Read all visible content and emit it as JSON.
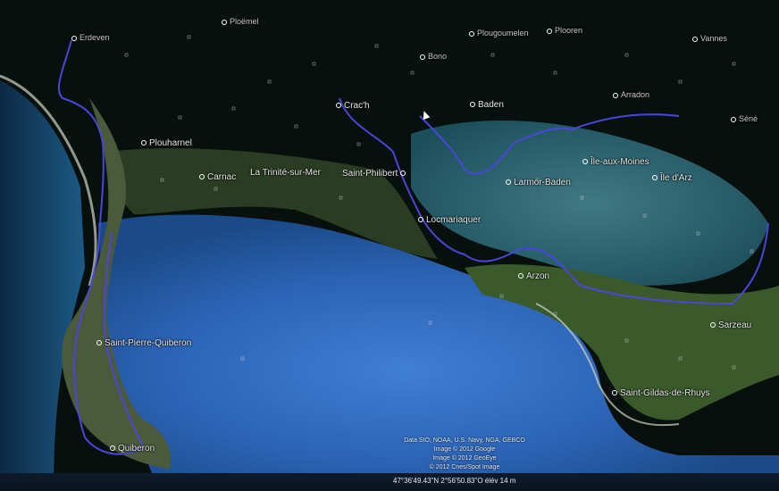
{
  "map": {
    "places": [
      {
        "id": "ploemel",
        "label": "Ploëmel",
        "faint": true
      },
      {
        "id": "erdeven",
        "label": "Erdeven",
        "faint": true
      },
      {
        "id": "plougoumelen",
        "label": "Plougoumelen",
        "faint": true
      },
      {
        "id": "plooren",
        "label": "Plooren",
        "faint": true
      },
      {
        "id": "vannes",
        "label": "Vannes",
        "faint": true
      },
      {
        "id": "bono",
        "label": "Bono",
        "faint": true
      },
      {
        "id": "arradon",
        "label": "Arradon",
        "faint": true
      },
      {
        "id": "crach",
        "label": "Crac'h",
        "faint": false
      },
      {
        "id": "baden",
        "label": "Baden",
        "faint": false
      },
      {
        "id": "sene",
        "label": "Séné",
        "faint": true
      },
      {
        "id": "plouharnel",
        "label": "Plouharnel",
        "faint": false
      },
      {
        "id": "carnac",
        "label": "Carnac",
        "faint": false
      },
      {
        "id": "trinite",
        "label": "La Trinité-sur-Mer",
        "faint": false
      },
      {
        "id": "philibert",
        "label": "Saint-Philibert",
        "faint": false
      },
      {
        "id": "ile-aux-moines",
        "label": "Île-aux-Moines",
        "faint": false
      },
      {
        "id": "ile-d-arz",
        "label": "Île d'Arz",
        "faint": false
      },
      {
        "id": "larmor-baden",
        "label": "Larmor-Baden",
        "faint": false
      },
      {
        "id": "locmariaquer",
        "label": "Locmariaquer",
        "faint": false
      },
      {
        "id": "arzon",
        "label": "Arzon",
        "faint": false
      },
      {
        "id": "sarzeau",
        "label": "Sarzeau",
        "faint": false
      },
      {
        "id": "saint-pierre",
        "label": "Saint-Pierre-Quiberon",
        "faint": false
      },
      {
        "id": "saint-gildas",
        "label": "Saint-Gildas-de-Rhuys",
        "faint": false
      },
      {
        "id": "quiberon",
        "label": "Quiberon",
        "faint": false
      }
    ],
    "attribution": [
      "Data SIO, NOAA, U.S. Navy, NGA, GEBCO",
      "Image © 2012 Google",
      "Image © 2012 GeoEye",
      "© 2012 Cnes/Spot Image"
    ],
    "status": {
      "coords": "47°36'49.43\"N    2°56'50.83\"O  élév    14 m"
    },
    "colors": {
      "sea_deep": "#1d4f9a",
      "sea_shallow": "#2f8fb0",
      "land": "#2f4a24",
      "night_land": "#07100c",
      "route": "#4a46d8",
      "label": "#e8e8e8"
    }
  }
}
